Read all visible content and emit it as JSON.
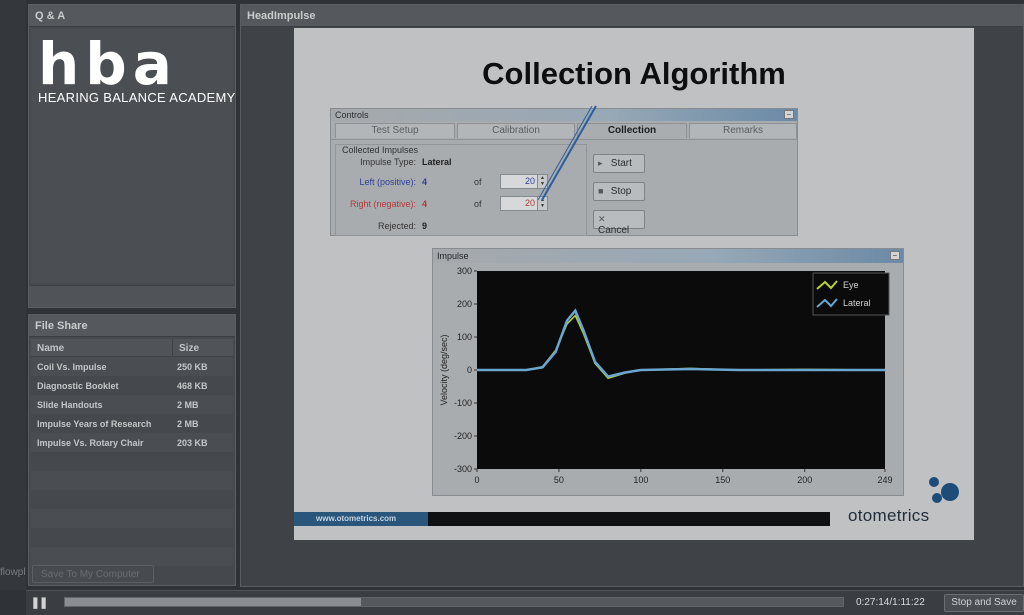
{
  "qa": {
    "title": "Q & A"
  },
  "logo": {
    "word": "hba",
    "subtitle": "HEARING BALANCE ACADEMY"
  },
  "file_share": {
    "title": "File Share",
    "columns": [
      "Name",
      "Size"
    ],
    "rows": [
      {
        "name": "Coil Vs. Impulse",
        "size": "250 KB"
      },
      {
        "name": "Diagnostic Booklet",
        "size": "468 KB"
      },
      {
        "name": "Slide Handouts",
        "size": "2 MB"
      },
      {
        "name": "Impulse Years of Research",
        "size": "2 MB"
      },
      {
        "name": "Impulse Vs. Rotary Chair",
        "size": "203 KB"
      }
    ],
    "save_label": "Save To My Computer",
    "flow_text": "flowpl"
  },
  "main": {
    "title": "HeadImpulse",
    "slide_title": "Collection Algorithm",
    "controls": {
      "title": "Controls",
      "tabs": [
        "Test Setup",
        "Calibration",
        "Collection",
        "Remarks"
      ],
      "active_tab": "Collection",
      "group_label": "Collected Impulses",
      "impulse_type_label": "Impulse Type:",
      "impulse_type_value": "Lateral",
      "left_label": "Left (positive):",
      "left_value": "4",
      "of_label": "of",
      "left_total": "20",
      "right_label": "Right (negative):",
      "right_value": "4",
      "right_total": "20",
      "rejected_label": "Rejected:",
      "rejected_value": "9",
      "start_label": "Start",
      "stop_label": "Stop",
      "cancel_label": "Cancel",
      "colors": {
        "left": "#2c3f9a",
        "right": "#b33a3a"
      }
    },
    "impulse": {
      "title": "Impulse",
      "legend_eye": "Eye",
      "legend_lateral": "Lateral"
    },
    "website": "www.otometrics.com",
    "brand": "otometrics"
  },
  "chart_data": {
    "type": "line",
    "title": "Impulse",
    "xlabel": "",
    "ylabel": "Velocity (deg/sec)",
    "xlim": [
      0,
      249
    ],
    "ylim": [
      -300,
      300
    ],
    "x_ticks": [
      0,
      50,
      100,
      150,
      200,
      249
    ],
    "y_ticks": [
      300,
      200,
      100,
      0,
      -100,
      -200,
      -300
    ],
    "legend": "top-right",
    "series": [
      {
        "name": "Eye",
        "color": "#b8d235",
        "x": [
          0,
          30,
          40,
          48,
          55,
          60,
          65,
          72,
          80,
          90,
          100,
          130,
          160,
          200,
          249
        ],
        "y": [
          0,
          0,
          10,
          60,
          140,
          165,
          110,
          20,
          -25,
          -10,
          0,
          5,
          0,
          2,
          0
        ]
      },
      {
        "name": "Lateral",
        "color": "#6aa6cf",
        "x": [
          0,
          30,
          40,
          48,
          55,
          60,
          65,
          72,
          80,
          90,
          100,
          130,
          160,
          200,
          249
        ],
        "y": [
          0,
          0,
          8,
          55,
          150,
          180,
          120,
          25,
          -20,
          -8,
          0,
          3,
          0,
          0,
          0
        ]
      }
    ]
  },
  "player": {
    "play_icon": "pause",
    "progress": 0.38,
    "time": "0:27:14/1:11:22",
    "stop_save_label": "Stop and Save"
  }
}
